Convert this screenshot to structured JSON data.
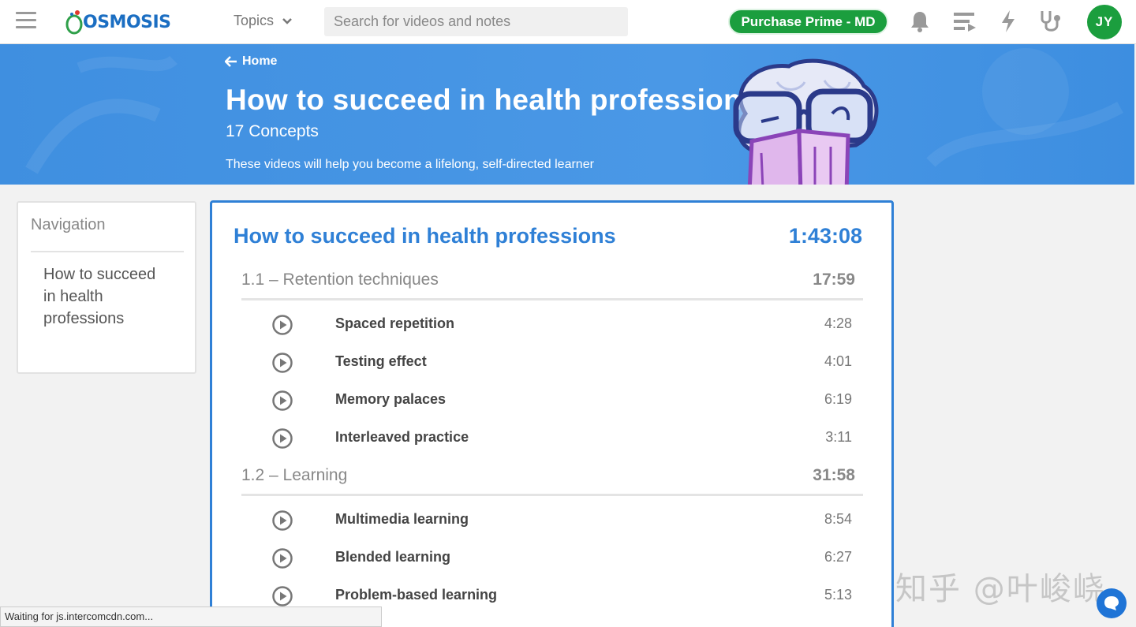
{
  "topnav": {
    "logo_text": "OSMOSIS",
    "topics_label": "Topics",
    "search_placeholder": "Search for videos and notes",
    "purchase_label": "Purchase Prime - MD",
    "avatar_initials": "JY",
    "icons": [
      "bell-icon",
      "playlist-icon",
      "lightning-icon",
      "stethoscope-icon"
    ]
  },
  "banner": {
    "home_label": "Home",
    "title": "How to succeed in health professions",
    "concepts": "17 Concepts",
    "description": "These videos will help you become a lifelong, self-directed learner"
  },
  "navigation": {
    "heading": "Navigation",
    "item": "How to succeed in health professions"
  },
  "course": {
    "title": "How to succeed in health professions",
    "total_duration": "1:43:08",
    "sections": [
      {
        "title": "1.1 – Retention techniques",
        "duration": "17:59",
        "videos": [
          {
            "name": "Spaced repetition",
            "duration": "4:28"
          },
          {
            "name": "Testing effect",
            "duration": "4:01"
          },
          {
            "name": "Memory palaces",
            "duration": "6:19"
          },
          {
            "name": "Interleaved practice",
            "duration": "3:11"
          }
        ]
      },
      {
        "title": "1.2 – Learning",
        "duration": "31:58",
        "videos": [
          {
            "name": "Multimedia learning",
            "duration": "8:54"
          },
          {
            "name": "Blended learning",
            "duration": "6:27"
          },
          {
            "name": "Problem-based learning",
            "duration": "5:13"
          }
        ]
      }
    ]
  },
  "statusbar": {
    "text": "Waiting for js.intercomcdn.com..."
  },
  "watermark": {
    "text": "知乎 @叶峻峣"
  },
  "colors": {
    "brand_blue": "#2f80d6",
    "prime_green": "#1b9e3e",
    "banner_blue": "#4a98e6"
  }
}
